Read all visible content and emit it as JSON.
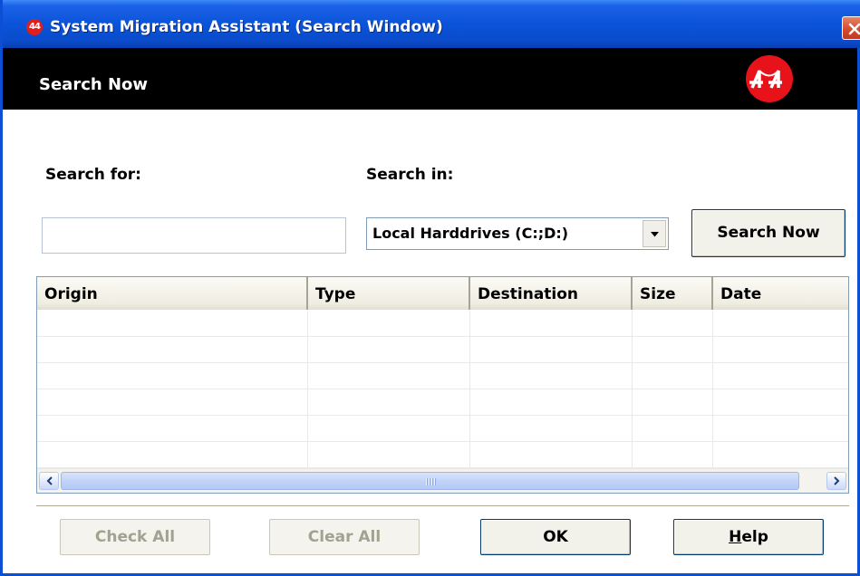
{
  "window": {
    "title": "System Migration Assistant (Search Window)",
    "icon_text": "44",
    "accent_color": "#0a53d8",
    "close_color": "#d2482b"
  },
  "banner": {
    "title": "Search Now",
    "logo_color": "#e8121a"
  },
  "search": {
    "search_for_label": "Search for:",
    "search_for_value": "",
    "search_in_label": "Search in:",
    "search_in_selected": "Local Harddrives (C:;D:)",
    "search_button_label": "Search Now"
  },
  "results_table": {
    "columns": [
      "Origin",
      "Type",
      "Destination",
      "Size",
      "Date"
    ],
    "rows": [
      [],
      [],
      [],
      [],
      [],
      []
    ]
  },
  "buttons": {
    "check_all": "Check All",
    "clear_all": "Clear All",
    "ok": "OK",
    "help_mnemonic": "H",
    "help_rest": "elp"
  }
}
